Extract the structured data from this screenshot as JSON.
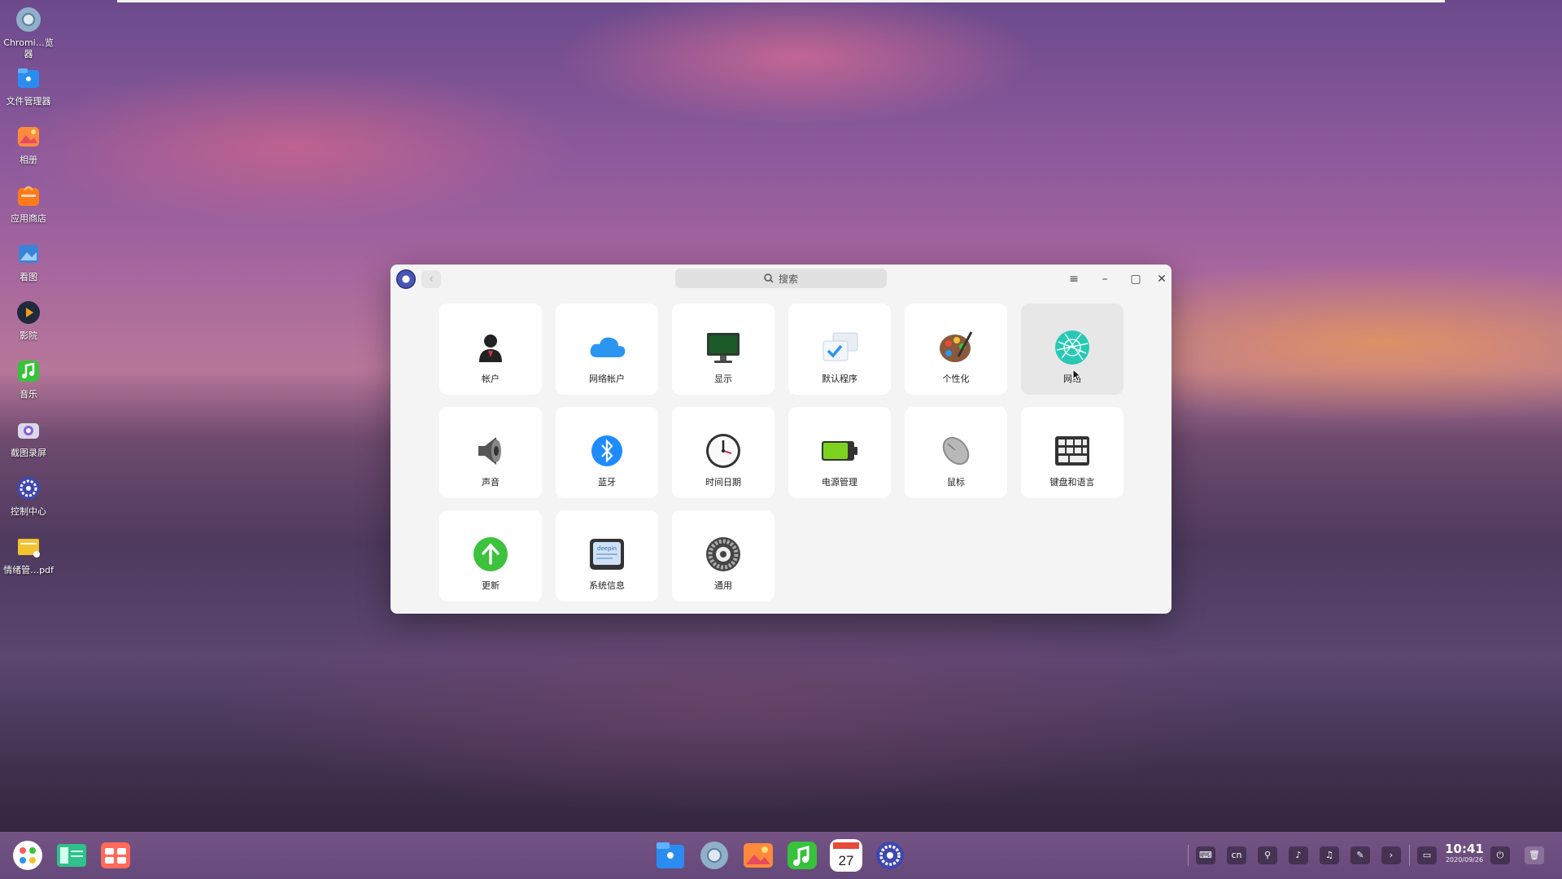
{
  "desktop": {
    "icons": [
      {
        "label": "Chromi…览器",
        "icon": "chromium-icon"
      },
      {
        "label": "文件管理器",
        "icon": "file-manager-icon"
      },
      {
        "label": "相册",
        "icon": "album-icon"
      },
      {
        "label": "应用商店",
        "icon": "app-store-icon"
      },
      {
        "label": "看图",
        "icon": "image-viewer-icon"
      },
      {
        "label": "影院",
        "icon": "movie-icon"
      },
      {
        "label": "音乐",
        "icon": "music-icon"
      },
      {
        "label": "截图录屏",
        "icon": "screenshot-icon"
      },
      {
        "label": "控制中心",
        "icon": "control-center-icon"
      },
      {
        "label": "情绪管…pdf",
        "icon": "pdf-file-icon"
      }
    ]
  },
  "window": {
    "search_placeholder": "搜索",
    "back_symbol": "‹",
    "menu_symbol": "≡",
    "minimize_symbol": "–",
    "maximize_symbol": "▢",
    "close_symbol": "✕",
    "modules": [
      {
        "label": "帐户",
        "icon": "account-icon"
      },
      {
        "label": "网络帐户",
        "icon": "cloud-account-icon"
      },
      {
        "label": "显示",
        "icon": "display-icon"
      },
      {
        "label": "默认程序",
        "icon": "default-apps-icon"
      },
      {
        "label": "个性化",
        "icon": "personalization-icon"
      },
      {
        "label": "网络",
        "icon": "network-icon",
        "hovered": true
      },
      {
        "label": "声音",
        "icon": "sound-icon"
      },
      {
        "label": "蓝牙",
        "icon": "bluetooth-icon"
      },
      {
        "label": "时间日期",
        "icon": "clock-icon"
      },
      {
        "label": "电源管理",
        "icon": "battery-icon"
      },
      {
        "label": "鼠标",
        "icon": "mouse-icon"
      },
      {
        "label": "键盘和语言",
        "icon": "keyboard-icon"
      },
      {
        "label": "更新",
        "icon": "update-icon"
      },
      {
        "label": "系统信息",
        "icon": "system-info-icon"
      },
      {
        "label": "通用",
        "icon": "general-icon"
      }
    ],
    "sysinfo_badge": "deepin"
  },
  "dock": {
    "calendar_day": "27",
    "tray_input_method": "cn",
    "clock_time": "10:41",
    "clock_date": "2020/09/26"
  },
  "colors": {
    "window_bg": "#f4f4f4",
    "tile_bg": "#ffffff",
    "tile_hover_bg": "#e7e7e7",
    "accent_blue": "#1e8cff",
    "accent_green": "#3cc23c"
  }
}
